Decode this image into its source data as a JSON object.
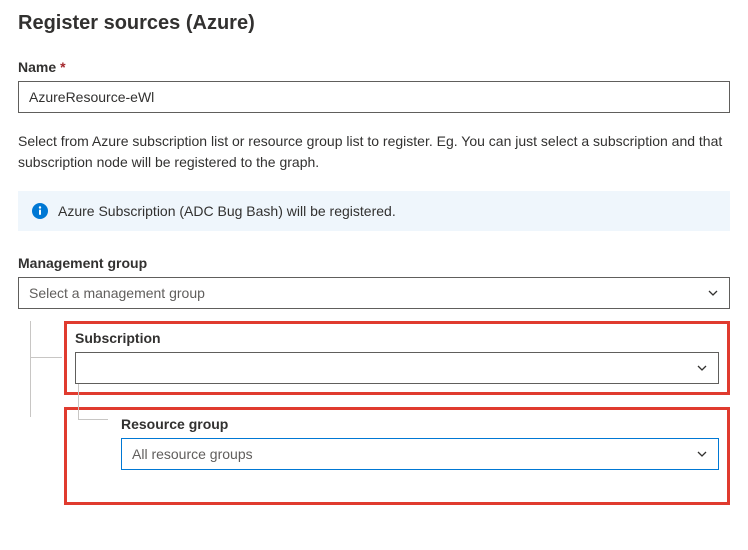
{
  "page": {
    "title": "Register sources (Azure)"
  },
  "nameField": {
    "label": "Name",
    "required_marker": "*",
    "value": "AzureResource-eWl"
  },
  "description": "Select from Azure subscription list or resource group list to register. Eg. You can just select a subscription and that subscription node will be registered to the graph.",
  "infoBanner": {
    "message": "Azure Subscription (ADC Bug Bash) will be registered."
  },
  "managementGroup": {
    "label": "Management group",
    "placeholder": "Select a management group"
  },
  "subscription": {
    "label": "Subscription",
    "value": ""
  },
  "resourceGroup": {
    "label": "Resource group",
    "value": "All resource groups"
  }
}
